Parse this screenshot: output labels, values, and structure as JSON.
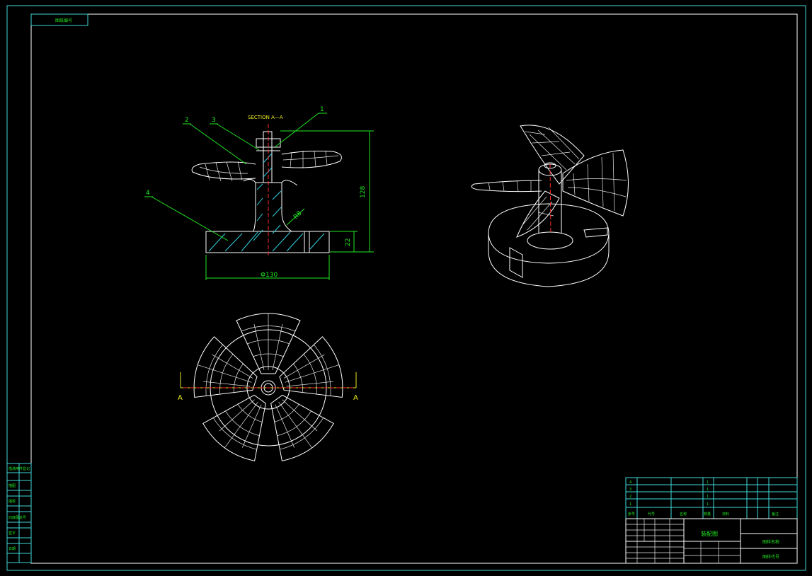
{
  "drawing": {
    "tag_top_left": "图纸编号",
    "section_title": "SECTION A—A",
    "balloons": [
      "1",
      "2",
      "3",
      "4"
    ],
    "dim_height": "128",
    "dim_foot": "22",
    "dim_radius": "R8",
    "dim_diameter": "Φ130",
    "section_mark": "A"
  },
  "left_panel": [
    "借通用件登记",
    "旧底图总号",
    "底图总号",
    "签字",
    "日期",
    "描图",
    "描校"
  ],
  "parts_list": {
    "rows": [
      {
        "no": "4",
        "qty": "1"
      },
      {
        "no": "3",
        "qty": "1"
      },
      {
        "no": "2",
        "qty": "1"
      },
      {
        "no": "1",
        "qty": "1"
      }
    ],
    "header": [
      "序号",
      "代号",
      "名称",
      "数量",
      "材料",
      "备注"
    ]
  },
  "title_block": {
    "title": "装配图",
    "drawing_no_label": "图样代号",
    "material_label": "图样名称"
  },
  "colors": {
    "frame": "#3fd8d8",
    "geometry": "#ffffff",
    "annotation": "#22e822",
    "hatch": "#2fd0e0",
    "centerline": "#ff2a2a",
    "section_text": "#e8e820"
  }
}
